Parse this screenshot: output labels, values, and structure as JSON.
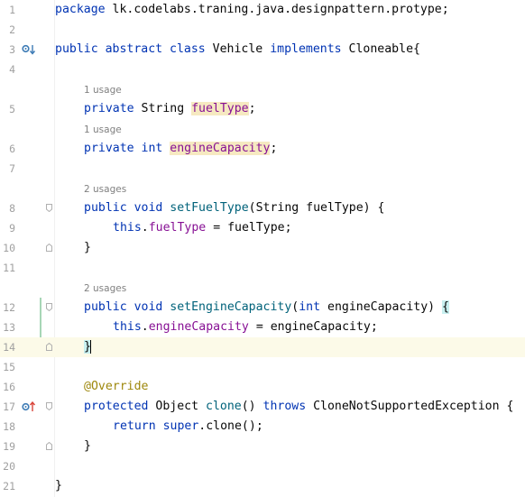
{
  "editor": {
    "line_numbers": [
      "1",
      "2",
      "3",
      "4",
      "5",
      "6",
      "7",
      "8",
      "9",
      "10",
      "11",
      "12",
      "13",
      "14",
      "15",
      "16",
      "17",
      "18",
      "19",
      "20",
      "21"
    ],
    "hints": {
      "fuel_field_usage": "1 usage",
      "engine_field_usage": "1 usage",
      "set_fuel_usages": "2 usages",
      "set_engine_usages": "2 usages"
    },
    "code": {
      "l1_kw": "package",
      "l1_rest": " lk.codelabs.traning.java.designpattern.protype;",
      "l3_kw": "public abstract class",
      "l3_name": " Vehicle ",
      "l3_impl": "implements",
      "l3_rest": " Cloneable{",
      "l5_kw": "private",
      "l5_type": " String ",
      "l5_field": "fuelType",
      "l5_end": ";",
      "l6_kw": "private int",
      "l6_field": "engineCapacity",
      "l6_end": ";",
      "l8_kw": "public void",
      "l8_fn": "setFuelType",
      "l8_rest": "(String fuelType) {",
      "l9_this": "this",
      "l9_dot": ".",
      "l9_field": "fuelType",
      "l9_rest": " = fuelType;",
      "close_brace": "}",
      "l12_kw": "public void",
      "l12_fn": "setEngineCapacity",
      "l12_paren": "(",
      "l12_int": "int",
      "l12_rest": " engineCapacity) ",
      "l12_brace": "{",
      "l13_this": "this",
      "l13_dot": ".",
      "l13_field": "engineCapacity",
      "l13_rest": " = engineCapacity;",
      "l14_brace": "}",
      "l16_ann": "@Override",
      "l17_kw": "protected",
      "l17_type": " Object ",
      "l17_fn": "clone",
      "l17_paren": "() ",
      "l17_throws": "throws",
      "l17_rest": " CloneNotSupportedException {",
      "l18_return": "return",
      "l18_super": "super",
      "l18_rest": ".clone();"
    },
    "colors": {
      "keyword": "#0033b3",
      "field": "#871094",
      "method": "#00627a",
      "annotation": "#9e880d",
      "current_line": "#fcfae8"
    },
    "icons": {
      "line3": "implementation-marker-icon",
      "line17": "override-marker-icon"
    }
  }
}
